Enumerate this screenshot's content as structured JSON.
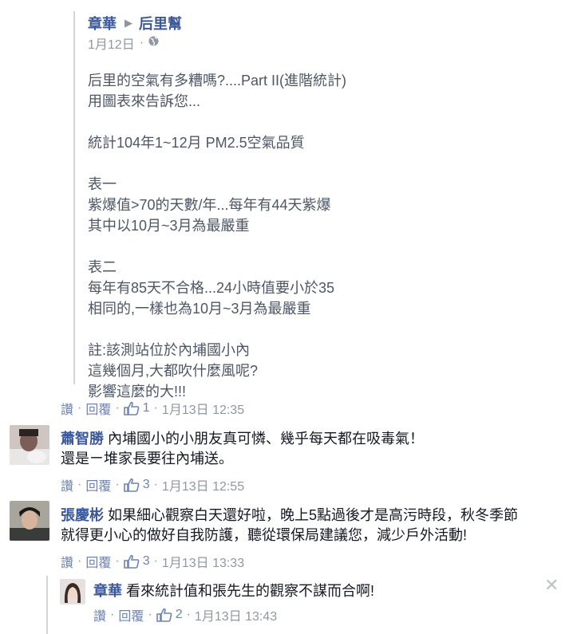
{
  "post": {
    "author": "章華",
    "group": "后里幫",
    "date": "1月12日",
    "dot": "·",
    "paragraphs": [
      [
        "后里的空氣有多糟嗎?....Part II(進階統計)",
        "用圖表來告訴您..."
      ],
      [
        "統計104年1~12月 PM2.5空氣品質"
      ],
      [
        "表一",
        "紫爆值>70的天數/年...每年有44天紫爆",
        "其中以10月~3月為最嚴重"
      ],
      [
        "表二",
        "每年有85天不合格...24小時值要小於35",
        "相同的,一樣也為10月~3月為最嚴重"
      ],
      [
        "註:該測站位於內埔國小內",
        "這幾個月,大都吹什麼風呢?",
        "影響這麼的大!!!"
      ]
    ],
    "actions": {
      "like": "讚",
      "reply": "回覆",
      "likes": "1",
      "time": "1月13日 12:35"
    }
  },
  "comments": [
    {
      "name": "蕭智勝",
      "text_line1": "內埔國小的小朋友真可憐、幾乎每天都在吸毒氣！",
      "text_line2": "還是ㄧ堆家長要往內埔送。",
      "like": "讚",
      "reply": "回覆",
      "likes": "3",
      "time": "1月13日 12:55"
    },
    {
      "name": "張慶彬",
      "text_line1": "如果細心觀察白天還好啦，晚上5點過後才是高污時段，秋冬季節",
      "text_line2": "就得更小心的做好自我防護，聽從環保局建議您，減少戶外活動!",
      "like": "讚",
      "reply": "回覆",
      "likes": "3",
      "time": "1月13日 13:33"
    }
  ],
  "reply": {
    "name": "章華",
    "text": "看來統計值和張先生的觀察不謀而合啊!",
    "like": "讚",
    "reply": "回覆",
    "likes": "2",
    "time": "1月13日 13:43",
    "close": "✕"
  },
  "colors": {
    "link": "#3b5998",
    "meta": "#9197a3",
    "body": "#4e5665"
  }
}
